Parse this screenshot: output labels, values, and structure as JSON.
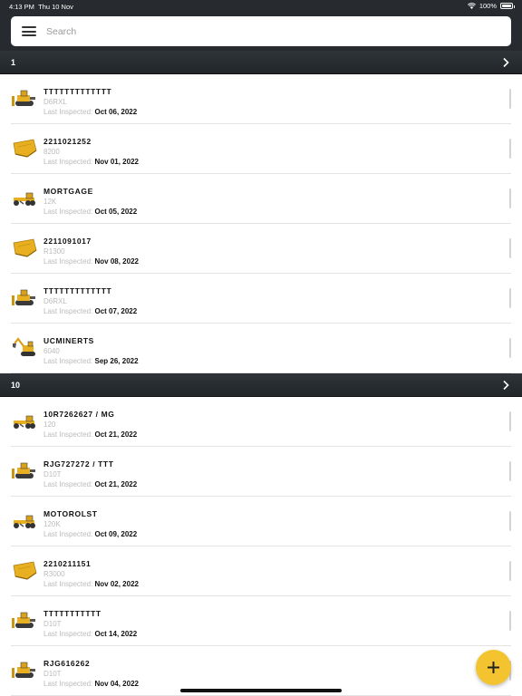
{
  "status_bar": {
    "time": "4:13 PM",
    "date": "Thu 10 Nov",
    "battery": "100%"
  },
  "search": {
    "placeholder": "Search",
    "value": ""
  },
  "colors": {
    "accent": "#f4c430",
    "header_bg": "#272b2f",
    "muted_text": "#bbbbbb"
  },
  "groups": [
    {
      "label": "1",
      "items": [
        {
          "title": "TTTTTTTTTTTTT",
          "model": "D6RXL",
          "inspected_label": "Last Inspected:",
          "inspected_date": "Oct 06, 2022",
          "icon": "dozer-icon"
        },
        {
          "title": "2211021252",
          "model": "8200",
          "inspected_label": "Last Inspected:",
          "inspected_date": "Nov 01, 2022",
          "icon": "bucket-icon"
        },
        {
          "title": "MORTGAGE",
          "model": "12K",
          "inspected_label": "Last Inspected:",
          "inspected_date": "Oct 05, 2022",
          "icon": "grader-icon"
        },
        {
          "title": "2211091017",
          "model": "R1300",
          "inspected_label": "Last Inspected:",
          "inspected_date": "Nov 08, 2022",
          "icon": "bucket-icon"
        },
        {
          "title": "TTTTTTTTTTTTT",
          "model": "D6RXL",
          "inspected_label": "Last Inspected:",
          "inspected_date": "Oct 07, 2022",
          "icon": "dozer-icon"
        },
        {
          "title": "UCMINERTS",
          "model": "6040",
          "inspected_label": "Last Inspected:",
          "inspected_date": "Sep 26, 2022",
          "icon": "excavator-icon"
        }
      ]
    },
    {
      "label": "10",
      "items": [
        {
          "title": "10R7262627 / MG",
          "model": "120",
          "inspected_label": "Last Inspected:",
          "inspected_date": "Oct 21, 2022",
          "icon": "grader-icon"
        },
        {
          "title": "RJG727272 / TTT",
          "model": "D10T",
          "inspected_label": "Last Inspected:",
          "inspected_date": "Oct 21, 2022",
          "icon": "dozer-icon"
        },
        {
          "title": "MOTOROLST",
          "model": "120K",
          "inspected_label": "Last Inspected:",
          "inspected_date": "Oct 09, 2022",
          "icon": "grader-icon"
        },
        {
          "title": "2210211151",
          "model": "R3000",
          "inspected_label": "Last Inspected:",
          "inspected_date": "Nov 02, 2022",
          "icon": "bucket-icon"
        },
        {
          "title": "TTTTTTTTTTT",
          "model": "D10T",
          "inspected_label": "Last Inspected:",
          "inspected_date": "Oct 14, 2022",
          "icon": "dozer-icon"
        },
        {
          "title": "RJG616262",
          "model": "D10T",
          "inspected_label": "Last Inspected:",
          "inspected_date": "Nov 04, 2022",
          "icon": "dozer-icon"
        }
      ]
    }
  ]
}
